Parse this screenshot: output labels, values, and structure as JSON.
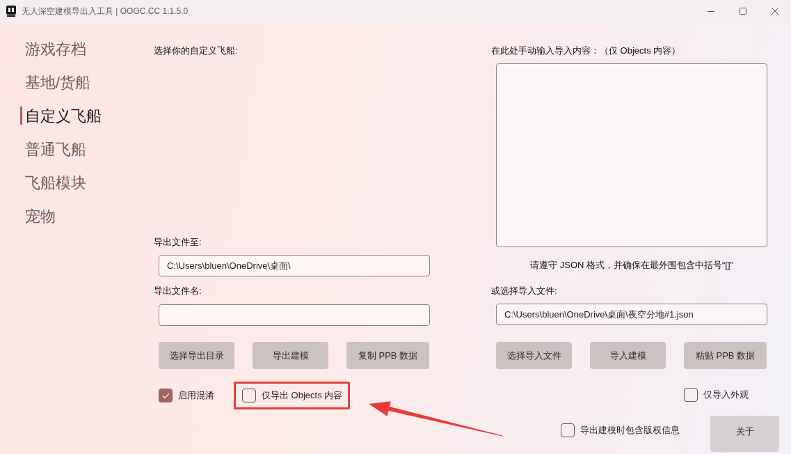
{
  "window": {
    "title": "无人深空建模导出入工具 | OOGC.CC 1.1.5.0"
  },
  "sidebar": {
    "items": [
      {
        "label": "游戏存档",
        "selected": false
      },
      {
        "label": "基地/货船",
        "selected": false
      },
      {
        "label": "自定义飞船",
        "selected": true
      },
      {
        "label": "普通飞船",
        "selected": false
      },
      {
        "label": "飞船模块",
        "selected": false
      },
      {
        "label": "宠物",
        "selected": false
      }
    ]
  },
  "export_panel": {
    "heading": "选择你的自定义飞船:",
    "path_label": "导出文件至:",
    "path_value": "C:\\Users\\bluen\\OneDrive\\桌面\\",
    "name_label": "导出文件名:",
    "buttons": [
      "选择导出目录",
      "导出建模",
      "复制 PPB 数据"
    ],
    "options": [
      {
        "label": "启用混淆",
        "checked": true,
        "highlighted": false
      },
      {
        "label": "仅导出 Objects 内容",
        "checked": false,
        "highlighted": true
      }
    ]
  },
  "import_panel": {
    "heading": "在此处手动输入导入内容：（仅 Objects 内容）",
    "hint": "请遵守 JSON 格式，并确保在最外围包含中括号“[]”",
    "file_label": "或选择导入文件:",
    "file_value": "C:\\Users\\bluen\\OneDrive\\桌面\\夜空分地#1.json",
    "buttons": [
      "选择导入文件",
      "导入建模",
      "粘贴 PPB 数据"
    ],
    "options": [
      {
        "label": "仅导入外观",
        "checked": false
      }
    ]
  },
  "footer": {
    "option": {
      "label": "导出建模时包含版权信息",
      "checked": false
    },
    "button": "关于"
  }
}
